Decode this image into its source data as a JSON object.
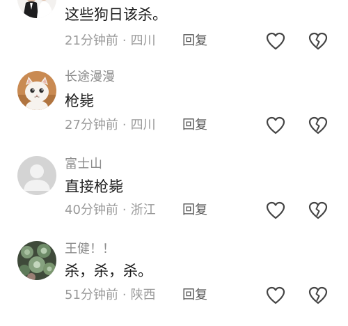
{
  "comments": [
    {
      "username": "",
      "content": "这些狗日该杀。",
      "time": "21分钟前",
      "separator": "·",
      "location": "四川",
      "reply_label": "回复",
      "avatar": "wedding-photo"
    },
    {
      "username": "长途漫漫",
      "content": "枪毙",
      "time": "27分钟前",
      "separator": "·",
      "location": "四川",
      "reply_label": "回复",
      "avatar": "white-cat-photo"
    },
    {
      "username": "富士山",
      "content": "直接枪毙",
      "time": "40分钟前",
      "separator": "·",
      "location": "浙江",
      "reply_label": "回复",
      "avatar": "default-person-avatar"
    },
    {
      "username": "王健！！",
      "content": "杀，杀，杀。",
      "time": "51分钟前",
      "separator": "·",
      "location": "陕西",
      "reply_label": "回复",
      "avatar": "succulent-plant-photo"
    }
  ],
  "icons": {
    "like": "heart-icon",
    "dislike": "broken-heart-icon"
  },
  "colors": {
    "username": "#8c8c8c",
    "content": "#1a1a1a",
    "meta": "#9a9a9a",
    "icon_stroke": "#444444"
  }
}
